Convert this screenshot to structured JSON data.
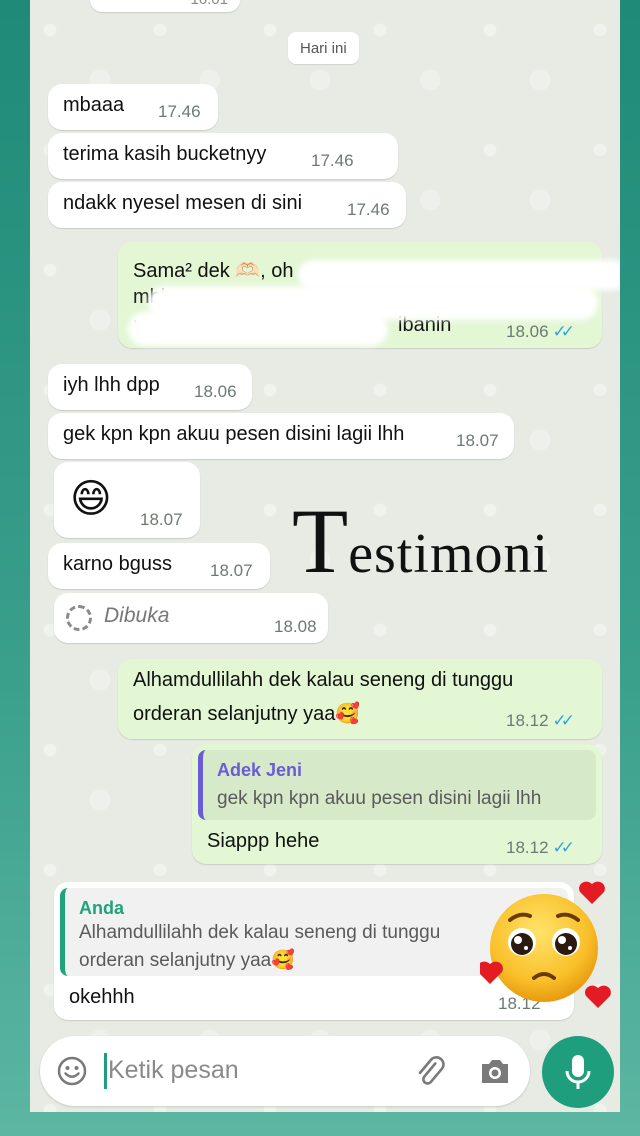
{
  "chat": {
    "date_chip": "Hari ini",
    "top_partial_time": "16.01",
    "messages": [
      {
        "dir": "in",
        "text": "mbaaa",
        "time": "17.46"
      },
      {
        "dir": "in",
        "text": "terima kasih bucketnyy",
        "time": "17.46"
      },
      {
        "dir": "in",
        "text": "ndakk nyesel mesen di sini",
        "time": "17.46"
      },
      {
        "dir": "out",
        "text_line1": "Sama² dek 🫶🏻, oh",
        "text_line2": "mbk",
        "text_line3": "n",
        "text_line3b": "ibanin",
        "time": "18.06",
        "ticks": "✓✓"
      },
      {
        "dir": "in",
        "text": "iyh lhh dpp",
        "time": "18.06"
      },
      {
        "dir": "in",
        "text": "gek kpn kpn akuu pesen disini lagii lhh",
        "time": "18.07"
      },
      {
        "dir": "in",
        "text": "😄",
        "time": "18.07"
      },
      {
        "dir": "in",
        "text": "karno bguss",
        "time": "18.07"
      },
      {
        "dir": "in",
        "text": "Dibuka",
        "time": "18.08"
      },
      {
        "dir": "out",
        "text_line1": "Alhamdullilahh dek kalau seneng di tunggu",
        "text_line2": "orderan selanjutny yaa🥰",
        "time": "18.12",
        "ticks": "✓✓"
      },
      {
        "dir": "out",
        "quote_name": "Adek Jeni",
        "quote_text": "gek kpn kpn akuu pesen disini lagii lhh",
        "text": "Siappp hehe",
        "time": "18.12",
        "ticks": "✓✓"
      },
      {
        "dir": "in",
        "quote_name": "Anda",
        "quote_line1": "Alhamdullilahh dek kalau seneng di tunggu",
        "quote_line2": "orderan selanjutny yaa🥰",
        "text": "okehhh",
        "time": "18.12"
      }
    ]
  },
  "watermark": {
    "first": "T",
    "rest": "estimoni"
  },
  "sticker": {
    "icon": "pleading-face-with-hearts-icon"
  },
  "input": {
    "placeholder": "Ketik pesan"
  },
  "colors": {
    "accent": "#1e9e7d",
    "out_bubble": "#e3f7d4",
    "ticks": "#34a3e0",
    "quote_anda": "#1fa37a",
    "quote_jeni": "#6b5bd6"
  }
}
